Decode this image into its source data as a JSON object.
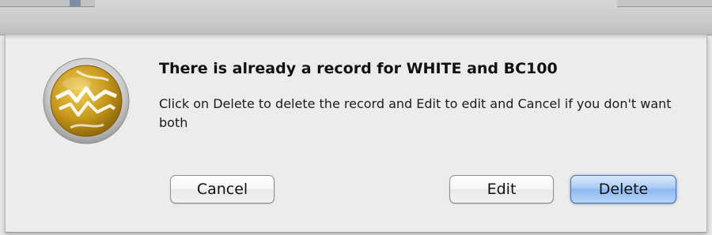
{
  "alert": {
    "title": "There is already a record for WHITE and BC100",
    "message": "Click on Delete to delete the record and Edit to edit and Cancel if you don't want both",
    "icon": "app-icon-gold-sphere"
  },
  "buttons": {
    "cancel_label": "Cancel",
    "edit_label": "Edit",
    "delete_label": "Delete"
  },
  "colors": {
    "default_button": "#8bb8f1",
    "icon_gold": "#c99a1c",
    "sheet_background": "#ececec"
  }
}
